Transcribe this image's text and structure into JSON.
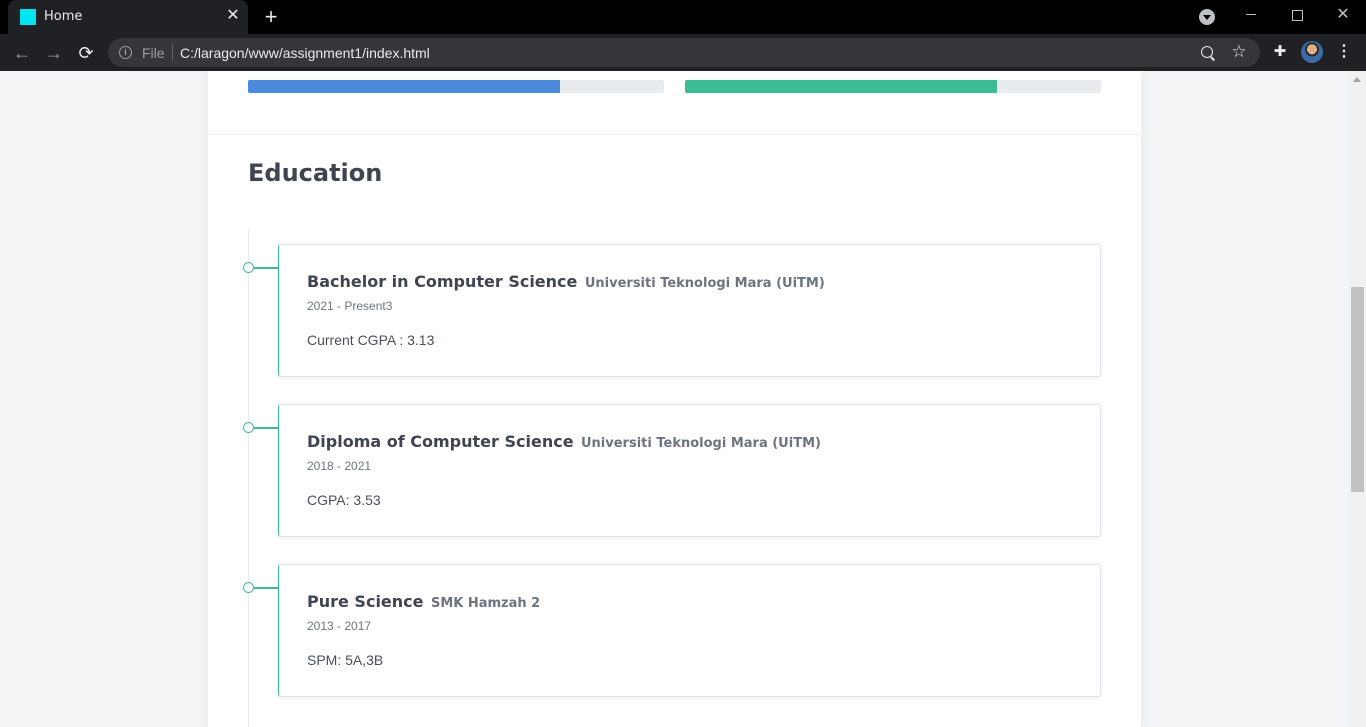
{
  "browser": {
    "tab_title": "Home",
    "tab_close": "✕",
    "new_tab": "+",
    "url_scheme": "File",
    "url": "C:/laragon/www/assignment1/index.html",
    "back": "←",
    "forward": "→",
    "reload": "⟳",
    "info": "i",
    "star": "☆",
    "extensions": "✚",
    "menu": "⋮",
    "window_close": "✕"
  },
  "skills": [
    {
      "progress": 0.75,
      "color": "#4c8bdc"
    },
    {
      "progress": 0.75,
      "color": "#3dbb95"
    }
  ],
  "education": {
    "title": "Education",
    "items": [
      {
        "degree": "Bachelor in Computer Science",
        "institution": "Universiti Teknologi Mara (UiTM)",
        "years": "2021 - Present3",
        "result": "Current CGPA : 3.13"
      },
      {
        "degree": "Diploma of Computer Science",
        "institution": "Universiti Teknologi Mara (UiTM)",
        "years": "2018 - 2021",
        "result": "CGPA: 3.53"
      },
      {
        "degree": "Pure Science",
        "institution": "SMK Hamzah 2",
        "years": "2013 - 2017",
        "result": "SPM: 5A,3B"
      }
    ]
  },
  "colors": {
    "accent_green": "#3dbb95",
    "accent_blue": "#4c8bdc"
  }
}
